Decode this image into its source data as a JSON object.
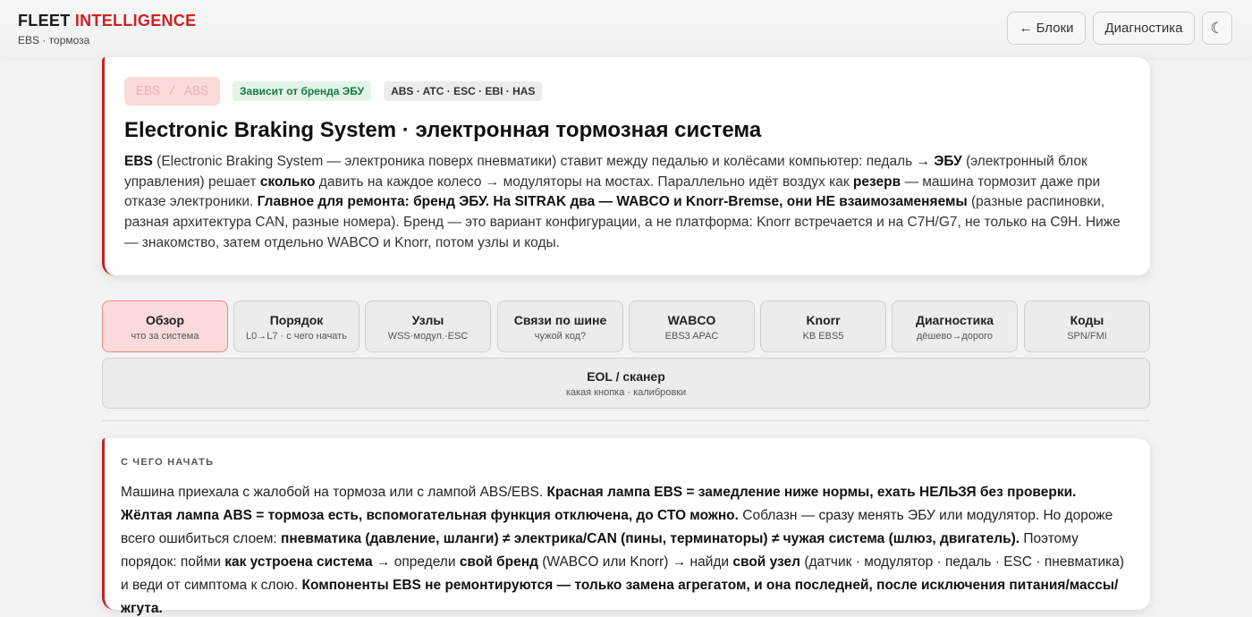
{
  "header": {
    "brand_main": "FLEET",
    "brand_accent": "INTELLIGENCE",
    "subtitle": "EBS · тормоза",
    "back_button": "← Блоки",
    "diag_button": "Диагностика",
    "theme_icon": "☾"
  },
  "hero": {
    "tag_primary": "EBS / ABS",
    "tag_brand": "Зависит от бренда ЭБУ",
    "tag_systems": "ABS · ATC · ESC · EBI · HAS",
    "title": "Electronic Braking System · электронная тормозная система",
    "p": [
      "EBS",
      " (Electronic Braking System — электроника поверх пневматики) ставит между педалью и колёсами компьютер: педаль ",
      "→ ЭБУ",
      " (электронный блок управления) решает ",
      "сколько",
      " давить на каждое колесо → модуляторы на мостах. Параллельно идёт воздух как ",
      "резерв",
      " — машина тормозит даже при отказе электроники. ",
      "Главное для ремонта: бренд ЭБУ. На SITRAK два — WABCO и Knorr-Bremse, они НЕ взаимозаменяемы",
      " (разные распиновки, разная архитектура CAN, разные номера). Бренд — это вариант конфигурации, а не платформа: Knorr встречается и на C7H/G7, не только на C9H. Ниже — знакомство, затем отдельно WABCO и Knorr, потом узлы и коды."
    ]
  },
  "tabs": [
    {
      "label": "Обзор",
      "sub": "что за система",
      "active": true
    },
    {
      "label": "Порядок",
      "sub": "L0→L7 · с чего начать"
    },
    {
      "label": "Узлы",
      "sub": "WSS·модул.·ESC"
    },
    {
      "label": "Связи по шине",
      "sub": "чужой код?"
    },
    {
      "label": "WABCO",
      "sub": "EBS3 APAC"
    },
    {
      "label": "Knorr",
      "sub": "KB EBS5"
    },
    {
      "label": "Диагностика",
      "sub": "дёшево→дорого"
    },
    {
      "label": "Коды",
      "sub": "SPN/FMI"
    },
    {
      "label": "EOL / сканер",
      "sub": "какая кнопка · калибровки"
    }
  ],
  "start": {
    "kicker": "С ЧЕГО НАЧАТЬ",
    "p": [
      "Машина приехала с жалобой на тормоза или с лампой ABS/EBS. ",
      "Красная лампа EBS = замедление ниже нормы, ехать НЕЛЬЗЯ без проверки. Жёлтая лампа ABS = тормоза есть, вспомогательная функция отключена, до СТО можно.",
      " Соблазн — сразу менять ЭБУ или модулятор. Но дороже всего ошибиться слоем: ",
      "пневматика (давление, шланги) ≠ электрика/CAN (пины, терминаторы) ≠ чужая система (шлюз, двигатель).",
      " Поэтому порядок: пойми ",
      "как устроена система",
      " → определи ",
      "свой бренд",
      " (WABCO или Knorr) → найди ",
      "свой узел",
      " (датчик · модулятор · педаль · ESC · пневматика) и веди от симптома к слою. ",
      "Компоненты EBS не ремонтируются — только замена агрегатом, и она последней, после исключения питания/массы/жгута."
    ]
  },
  "colors": {
    "accent": "#d11f24",
    "active_tab": "#fadadb",
    "tag_green_bg": "#e2f3e7",
    "tag_green_text": "#177a3e"
  }
}
